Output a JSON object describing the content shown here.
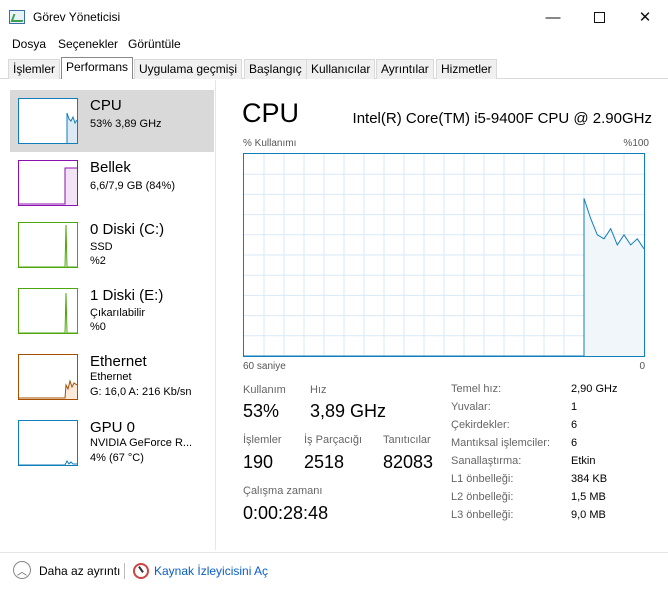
{
  "window": {
    "title": "Görev Yöneticisi",
    "minimize_glyph": "—",
    "close_glyph": "✕"
  },
  "menu": [
    "Dosya",
    "Seçenekler",
    "Görüntüle"
  ],
  "tabs": [
    "İşlemler",
    "Performans",
    "Uygulama geçmişi",
    "Başlangıç",
    "Kullanıcılar",
    "Ayrıntılar",
    "Hizmetler"
  ],
  "active_tab": "Performans",
  "sidebar": [
    {
      "title": "CPU",
      "lines": [
        "53% 3,89 GHz"
      ],
      "color": "#117dbb",
      "selected": true
    },
    {
      "title": "Bellek",
      "lines": [
        "6,6/7,9 GB (84%)"
      ],
      "color": "#8b12ae",
      "selected": false
    },
    {
      "title": "0 Diski (C:)",
      "lines": [
        "SSD",
        "%2"
      ],
      "color": "#4da60c",
      "selected": false
    },
    {
      "title": "1 Diski (E:)",
      "lines": [
        "Çıkarılabilir",
        "%0"
      ],
      "color": "#4da60c",
      "selected": false
    },
    {
      "title": "Ethernet",
      "lines": [
        "Ethernet",
        "G: 16,0 A: 216 Kb/sn"
      ],
      "color": "#a74f01",
      "selected": false
    },
    {
      "title": "GPU 0",
      "lines": [
        "NVIDIA GeForce R...",
        "4% (67 °C)"
      ],
      "color": "#117dbb",
      "selected": false
    }
  ],
  "main": {
    "title": "CPU",
    "model": "Intel(R) Core(TM) i5-9400F CPU @ 2.90GHz",
    "axis_label": "% Kullanımı",
    "axis_max": "%100",
    "time_span": "60 saniye",
    "time_end": "0",
    "accent_color": "#117dbb"
  },
  "chart_data": {
    "type": "area",
    "title": "",
    "xlabel": "60 saniye",
    "ylabel": "% Kullanımı",
    "xlim": [
      60,
      0
    ],
    "ylim": [
      0,
      100
    ],
    "grid": true,
    "series": [
      {
        "x": [
          60,
          9,
          9,
          8,
          7,
          6,
          5,
          4,
          3,
          2,
          1,
          0
        ],
        "y": [
          0,
          0,
          78,
          68,
          60,
          58,
          63,
          55,
          60,
          55,
          58,
          53
        ]
      }
    ]
  },
  "stats": {
    "kullanim_label": "Kullanım",
    "kullanim_value": "53%",
    "hiz_label": "Hız",
    "hiz_value": "3,89 GHz",
    "islemler_label": "İşlemler",
    "islemler_value": "190",
    "parcacik_label": "İş Parçacığı",
    "parcacik_value": "2518",
    "tanitici_label": "Tanıtıcılar",
    "tanitici_value": "82083",
    "calisma_label": "Çalışma zamanı",
    "calisma_value": "0:00:28:48"
  },
  "specs": [
    {
      "label": "Temel hız:",
      "value": "2,90 GHz"
    },
    {
      "label": "Yuvalar:",
      "value": "1"
    },
    {
      "label": "Çekirdekler:",
      "value": "6"
    },
    {
      "label": "Mantıksal işlemciler:",
      "value": "6"
    },
    {
      "label": "Sanallaştırma:",
      "value": "Etkin"
    },
    {
      "label": "L1 önbelleği:",
      "value": "384 KB"
    },
    {
      "label": "L2 önbelleği:",
      "value": "1,5 MB"
    },
    {
      "label": "L3 önbelleği:",
      "value": "9,0 MB"
    }
  ],
  "footer": {
    "less_details": "Daha az ayrıntı",
    "resource_monitor": "Kaynak İzleyicisini Aç",
    "link_color": "#0a5ec7"
  }
}
